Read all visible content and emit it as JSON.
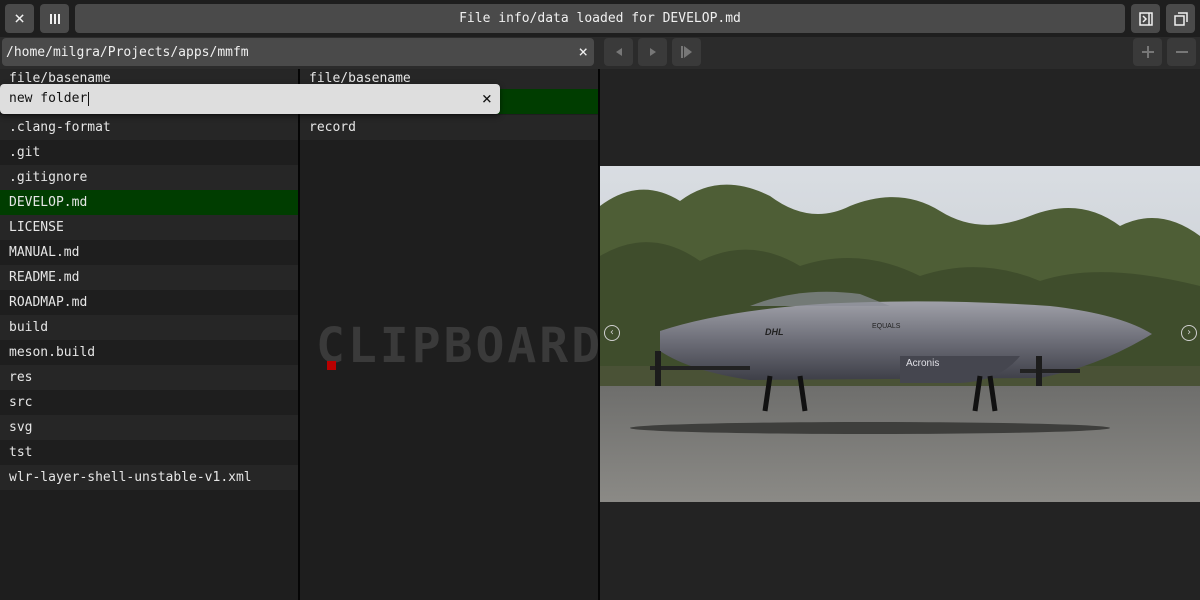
{
  "window": {
    "title": "File info/data loaded for DEVELOP.md",
    "close_icon": "×",
    "columns_icon": "|||",
    "panel_icon": "panel-toggle-icon",
    "fullscreen_icon": "fullscreen-icon"
  },
  "location": {
    "path": "/home/milgra/Projects/apps/mmfm",
    "clear_icon": "×"
  },
  "left_pane": {
    "header": "file/basename",
    "items": [
      ".clang-format",
      ".git",
      ".gitignore",
      "DEVELOP.md",
      "LICENSE",
      "MANUAL.md",
      "README.md",
      "ROADMAP.md",
      "build",
      "meson.build",
      "res",
      "src",
      "svg",
      "tst",
      "wlr-layer-shell-unstable-v1.xml"
    ],
    "selected": "DEVELOP.md"
  },
  "middle_pane": {
    "header": "file/basename",
    "items": [
      "record"
    ],
    "watermark": "CLIPBOARD"
  },
  "new_folder_dialog": {
    "value": "new folder",
    "close_icon": "×"
  },
  "colors": {
    "selection": "#003d00",
    "accent_red": "#b80000"
  }
}
